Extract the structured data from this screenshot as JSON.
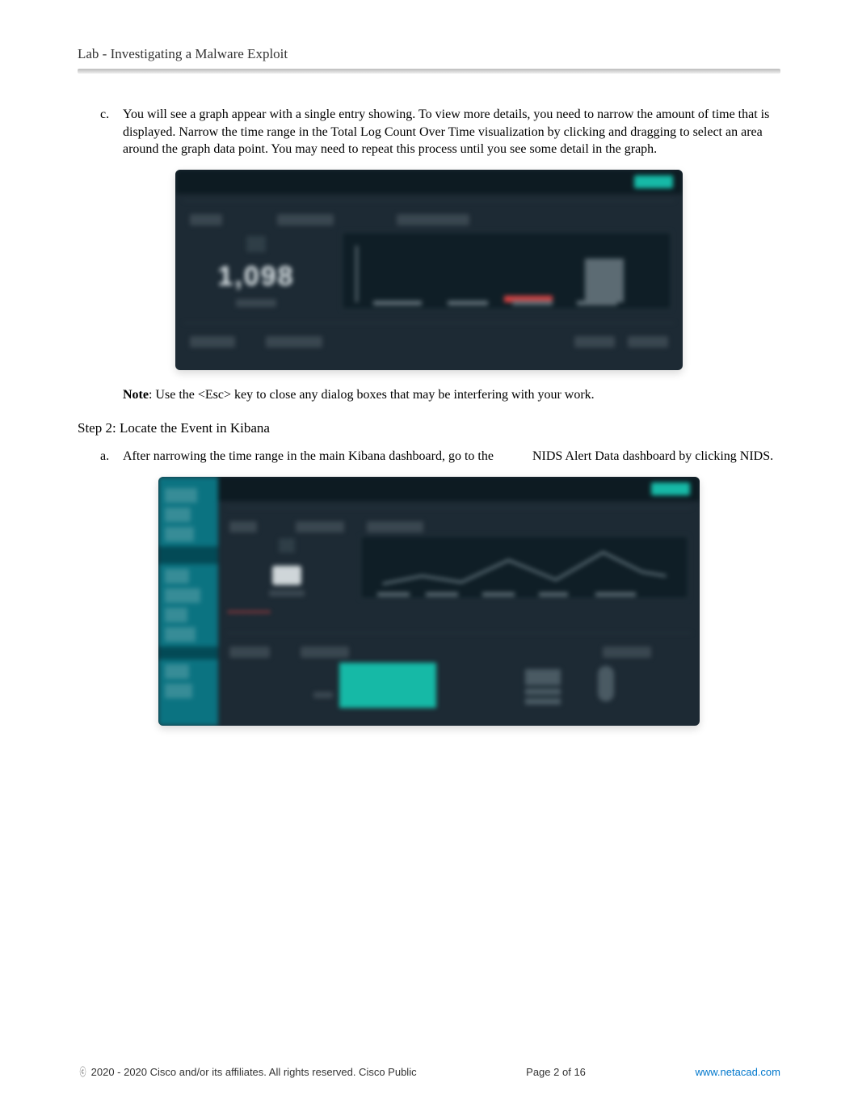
{
  "header": {
    "title": "Lab - Investigating a Malware Exploit"
  },
  "items": {
    "c": {
      "marker": "c.",
      "text": "You will see a graph appear with a single entry showing. To view more details, you need to narrow the amount of time that is displayed. Narrow the time range in the Total Log Count Over Time visualization by clicking and dragging to select an area around the graph data point. You may need to repeat this process until you see some detail in the graph."
    },
    "a": {
      "marker": "a.",
      "text_pre": "After narrowing the time range in the main Kibana dashboard, go to the",
      "text_post": "NIDS Alert Data dashboard by clicking NIDS."
    }
  },
  "note": {
    "label": "Note",
    "text": ": Use the <Esc> key to close any dialog boxes that may be interfering with your work."
  },
  "step2": {
    "heading": "Step 2: Locate the Event in Kibana"
  },
  "figure1": {
    "big_number_placeholder": "1,098"
  },
  "footer": {
    "copyright": " 2020 - 2020 Cisco and/or its affiliates. All rights reserved. Cisco Public",
    "page_label": "Page ",
    "page_current": "2",
    "page_sep": " of ",
    "page_total": "16",
    "url": "www.netacad.com"
  }
}
